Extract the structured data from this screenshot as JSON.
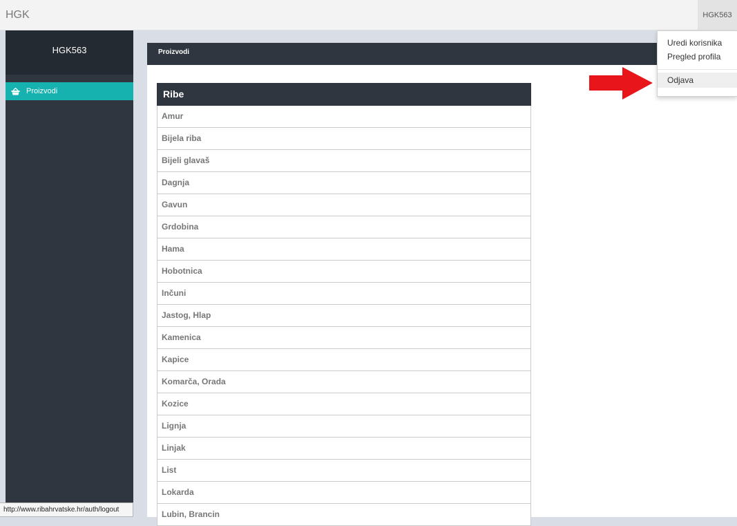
{
  "topbar": {
    "brand": "HGK",
    "user": "HGK563"
  },
  "sidebar": {
    "header": "HGK563",
    "items": [
      {
        "label": "Proizvodi",
        "icon": "basket-icon"
      }
    ]
  },
  "panel": {
    "title": "Proizvodi"
  },
  "table": {
    "header": "Ribe",
    "rows": [
      "Amur",
      "Bijela riba",
      "Bijeli glavaš",
      "Dagnja",
      "Gavun",
      "Grdobina",
      "Hama",
      "Hobotnica",
      "Inčuni",
      "Jastog, Hlap",
      "Kamenica",
      "Kapice",
      "Komarča, Orada",
      "Kozice",
      "Lignja",
      "Linjak",
      "List",
      "Lokarda",
      "Lubin, Brancin"
    ]
  },
  "dropdown": {
    "items": [
      "Uredi korisnika",
      "Pregled profila"
    ],
    "logout": "Odjava"
  },
  "statusbar": {
    "url": "http://www.ribahrvatske.hr/auth/logout"
  },
  "colors": {
    "accent": "#16b2b0",
    "dark": "#2f363f",
    "arrow": "#e8161b"
  }
}
